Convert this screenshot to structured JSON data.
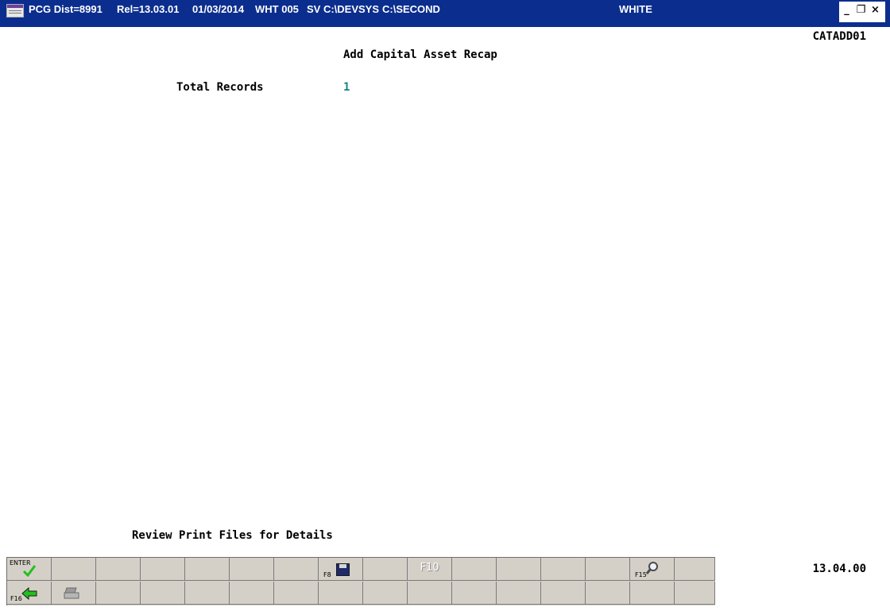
{
  "window": {
    "title_segments": [
      "PCG Dist=8991",
      "Rel=13.03.01",
      "01/03/2014",
      "WHT 005",
      "SV C:\\DEVSYS",
      "C:\\SECOND",
      "WHITE"
    ],
    "controls": {
      "minimize": "_",
      "maximize": "❐",
      "close": "×"
    }
  },
  "screen": {
    "id": "CATADD01",
    "title": "Add Capital Asset Recap",
    "total_records_label": "Total Records",
    "total_records_value": "1",
    "message": "Review Print Files for Details",
    "clock": "13.04.00"
  },
  "function_keys": {
    "row1": {
      "enter_label": "ENTER",
      "f8_label": "F8",
      "f10_label": "F10",
      "f15_label": "F15"
    },
    "row2": {
      "f16_label": "F16"
    }
  },
  "colors": {
    "titlebar": "#0b2e8e",
    "value": "#118585",
    "fkey_panel": "#d4d0c8",
    "accent_green": "#22c01d"
  },
  "icons": [
    "app-icon",
    "check-icon",
    "save-icon",
    "zoom-icon",
    "back-arrow-icon",
    "print-icon"
  ]
}
